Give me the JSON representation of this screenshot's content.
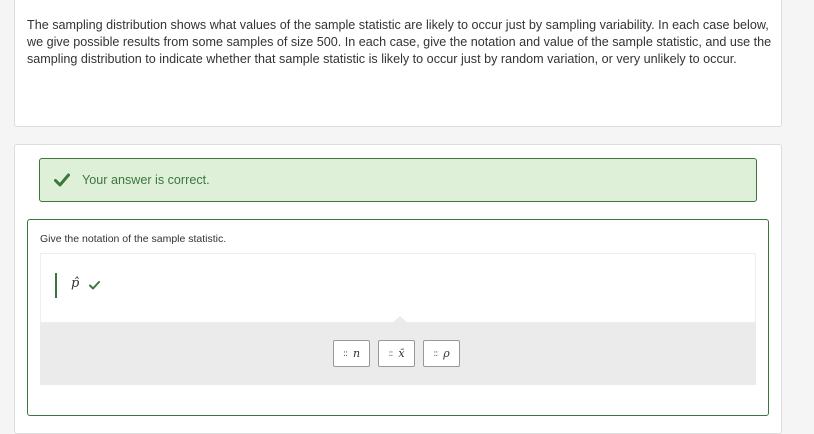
{
  "intro": {
    "text": "The sampling distribution shows what values of the sample statistic are likely to occur just by sampling variability. In each case below, we give possible results from some samples of size 500. In each case, give the notation and value of the sample statistic, and use the sampling distribution to indicate whether that sample statistic is likely to occur just by random variation, or very unlikely to occur."
  },
  "feedback": {
    "text": "Your answer is correct.",
    "icon": "check-icon",
    "color": "#3c763d"
  },
  "question": {
    "label": "Give the notation of the sample statistic.",
    "answer": "p̂",
    "answer_status_icon": "check-icon"
  },
  "tray": {
    "options": [
      {
        "grip": "::",
        "symbol": "n"
      },
      {
        "grip": "::",
        "symbol": "x̄"
      },
      {
        "grip": "::",
        "symbol": "ρ"
      }
    ]
  }
}
